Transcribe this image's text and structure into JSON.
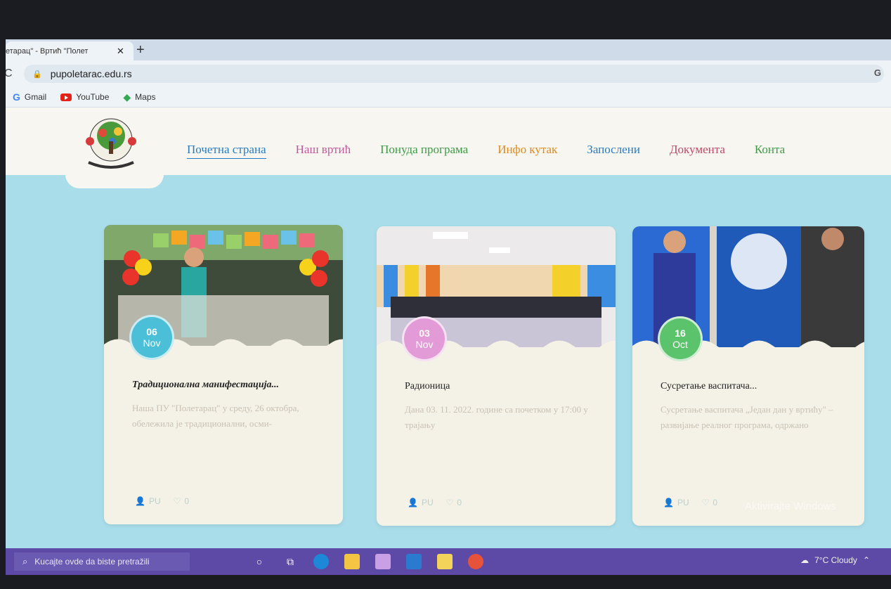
{
  "browser": {
    "tab_title": "етарац\" - Вртић \"Полет",
    "close_glyph": "✕",
    "new_tab_glyph": "+",
    "back_glyph": "C",
    "url": "pupoletarac.edu.rs",
    "account_glyph": "G",
    "bookmarks": [
      {
        "label": "Gmail",
        "icon": "google-icon"
      },
      {
        "label": "YouTube",
        "icon": "youtube-icon"
      },
      {
        "label": "Maps",
        "icon": "maps-icon"
      }
    ]
  },
  "site": {
    "nav": [
      {
        "label": "Почетна страна",
        "color": "#2a7bbf"
      },
      {
        "label": "Наш вртић",
        "color": "#c05a9a"
      },
      {
        "label": "Понуда програма",
        "color": "#3f9a47"
      },
      {
        "label": "Инфо кутак",
        "color": "#e08a1e"
      },
      {
        "label": "Запослени",
        "color": "#2a7bbf"
      },
      {
        "label": "Документа",
        "color": "#c04a6a"
      },
      {
        "label": "Конта",
        "color": "#3f9a47"
      }
    ]
  },
  "cards": [
    {
      "day": "06",
      "month": "Nov",
      "badge_color": "#4bbfd8",
      "title": "Традиционална манифестација...",
      "excerpt": "Наша ПУ \"Полетарац\" у среду, 26 октобра, обележила је традиционални, осми-",
      "author": "PU",
      "likes": "0"
    },
    {
      "day": "03",
      "month": "Nov",
      "badge_color": "#e29bd6",
      "title": "Радионица",
      "excerpt": "Дана 03. 11. 2022. године са почетком у 17:00 у трајању",
      "author": "PU",
      "likes": "0"
    },
    {
      "day": "16",
      "month": "Oct",
      "badge_color": "#5bc36c",
      "title": "Сусретање васпитача...",
      "excerpt": "Сусретање васпитача „Један дан у вртићу\" – развијање реалног програма, одржано",
      "author": "PU",
      "likes": "0"
    }
  ],
  "taskbar": {
    "search_placeholder": "Kucajte ovde da biste pretražili",
    "weather": "7°C  Cloudy"
  },
  "watermark": "Aktivirajte Windows"
}
